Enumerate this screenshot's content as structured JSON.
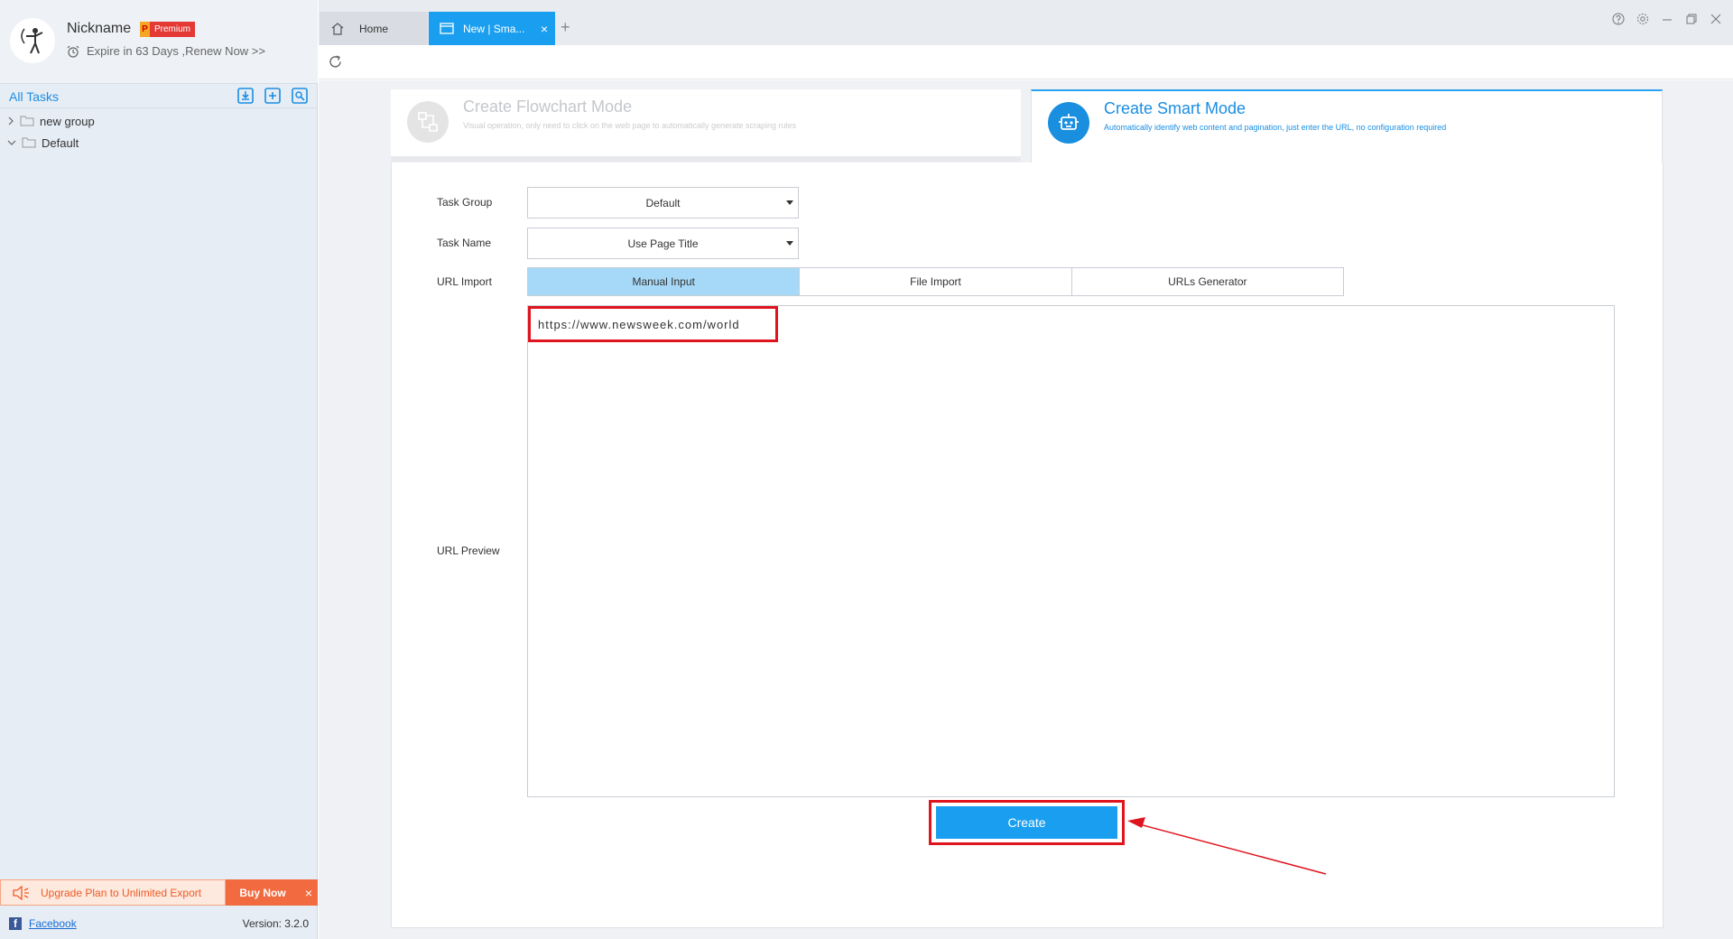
{
  "profile": {
    "nickname": "Nickname",
    "badge_p": "P",
    "badge_label": "Premium",
    "expire_text": "Expire in 63 Days ,Renew Now >>"
  },
  "sidebar": {
    "all_tasks": "All Tasks",
    "tools": [
      "import-icon",
      "add-task-icon",
      "search-task-icon"
    ],
    "tree": [
      {
        "label": "new group",
        "expanded": false
      },
      {
        "label": "Default",
        "expanded": true
      }
    ],
    "upgrade_text": "Upgrade Plan to Unlimited Export",
    "buy_now": "Buy Now",
    "close": "×",
    "facebook": "Facebook",
    "version": "Version: 3.2.0"
  },
  "tabs": {
    "home": "Home",
    "active": "New | Sma...",
    "close": "×",
    "add": "+"
  },
  "modes": {
    "flowchart": {
      "title": "Create Flowchart Mode",
      "desc": "Visual operation, only need to click on the web page to automatically generate scraping rules"
    },
    "smart": {
      "title": "Create Smart Mode",
      "desc": "Automatically identify web content and pagination, just enter the URL, no configuration required"
    }
  },
  "form": {
    "task_group_label": "Task Group",
    "task_group_value": "Default",
    "task_name_label": "Task Name",
    "task_name_value": "Use Page Title",
    "url_import_label": "URL Import",
    "url_import_options": [
      "Manual Input",
      "File Import",
      "URLs Generator"
    ],
    "url_import_selected": "Manual Input",
    "url_preview_label": "URL Preview",
    "url_value": "https://www.newsweek.com/world",
    "create_button": "Create"
  },
  "colors": {
    "accent": "#1a9ff0",
    "highlight": "#e0141f",
    "sidebar_bg": "#e6edf5"
  }
}
